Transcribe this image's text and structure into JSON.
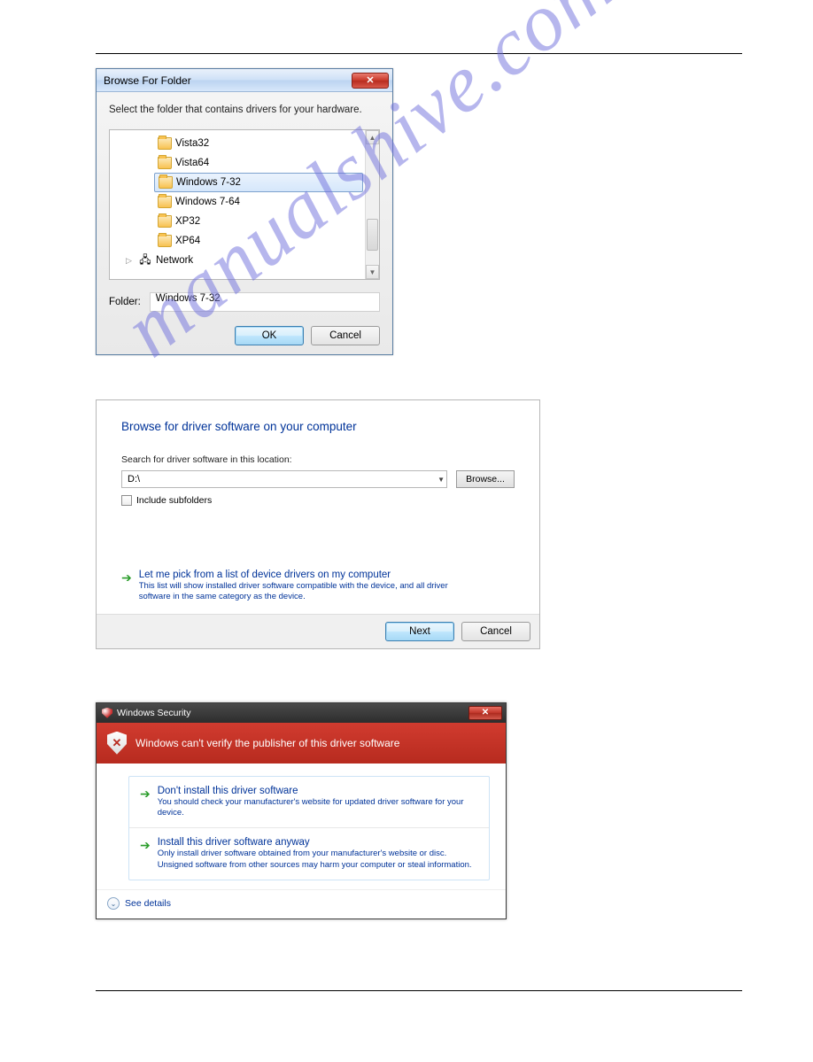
{
  "watermark": "manualshive.com",
  "dlg1": {
    "title": "Browse For Folder",
    "instruction": "Select the folder that contains drivers for your hardware.",
    "items": [
      {
        "label": "Vista32"
      },
      {
        "label": "Vista64"
      },
      {
        "label": "Windows 7-32",
        "selected": true
      },
      {
        "label": "Windows 7-64"
      },
      {
        "label": "XP32"
      },
      {
        "label": "XP64"
      }
    ],
    "network_label": "Network",
    "folder_label": "Folder:",
    "folder_value": "Windows 7-32",
    "ok": "OK",
    "cancel": "Cancel"
  },
  "dlg2": {
    "heading": "Browse for driver software on your computer",
    "search_label": "Search for driver software in this location:",
    "path_value": "D:\\",
    "browse": "Browse...",
    "include_subfolders": "Include subfolders",
    "link_title": "Let me pick from a list of device drivers on my computer",
    "link_desc": "This list will show installed driver software compatible with the device, and all driver software in the same category as the device.",
    "next": "Next",
    "cancel": "Cancel"
  },
  "dlg3": {
    "title": "Windows Security",
    "banner": "Windows can't verify the publisher of this driver software",
    "opt1_title": "Don't install this driver software",
    "opt1_desc": "You should check your manufacturer's website for updated driver software for your device.",
    "opt2_title": "Install this driver software anyway",
    "opt2_desc": "Only install driver software obtained from your manufacturer's website or disc. Unsigned software from other sources may harm your computer or steal information.",
    "see_details": "See details"
  }
}
